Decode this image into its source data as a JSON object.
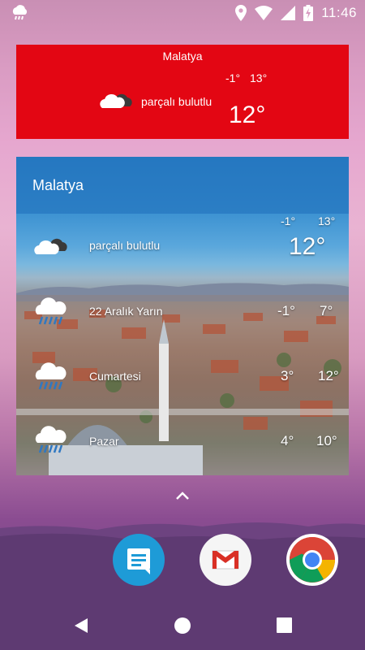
{
  "status_bar": {
    "time": "11:46",
    "icons": [
      "weather-app-notification-icon",
      "location-icon",
      "wifi-icon",
      "cellular-signal-icon",
      "battery-charging-icon"
    ]
  },
  "red_widget": {
    "city": "Malatya",
    "condition": "parçalı bulutlu",
    "min": "-1°",
    "max": "13°",
    "temp": "12°",
    "icon": "partly-cloudy-icon",
    "bg_color": "#e30613"
  },
  "photo_widget": {
    "city": "Malatya",
    "current": {
      "condition": "parçalı bulutlu",
      "min": "-1°",
      "max": "13°",
      "temp": "12°",
      "icon": "partly-cloudy-icon"
    },
    "forecast": [
      {
        "day": "22 Aralık Yarın",
        "min": "-1°",
        "max": "7°",
        "icon": "rain-cloud-icon"
      },
      {
        "day": "Cumartesi",
        "min": "3°",
        "max": "12°",
        "icon": "rain-cloud-icon"
      },
      {
        "day": "Pazar",
        "min": "4°",
        "max": "10°",
        "icon": "rain-cloud-icon"
      }
    ]
  },
  "dock": {
    "apps": [
      {
        "name": "Messages",
        "icon": "messages-icon"
      },
      {
        "name": "Gmail",
        "icon": "gmail-icon"
      },
      {
        "name": "Chrome",
        "icon": "chrome-icon"
      }
    ]
  },
  "nav_bar": {
    "buttons": [
      "back-icon",
      "home-icon",
      "recents-icon"
    ]
  }
}
